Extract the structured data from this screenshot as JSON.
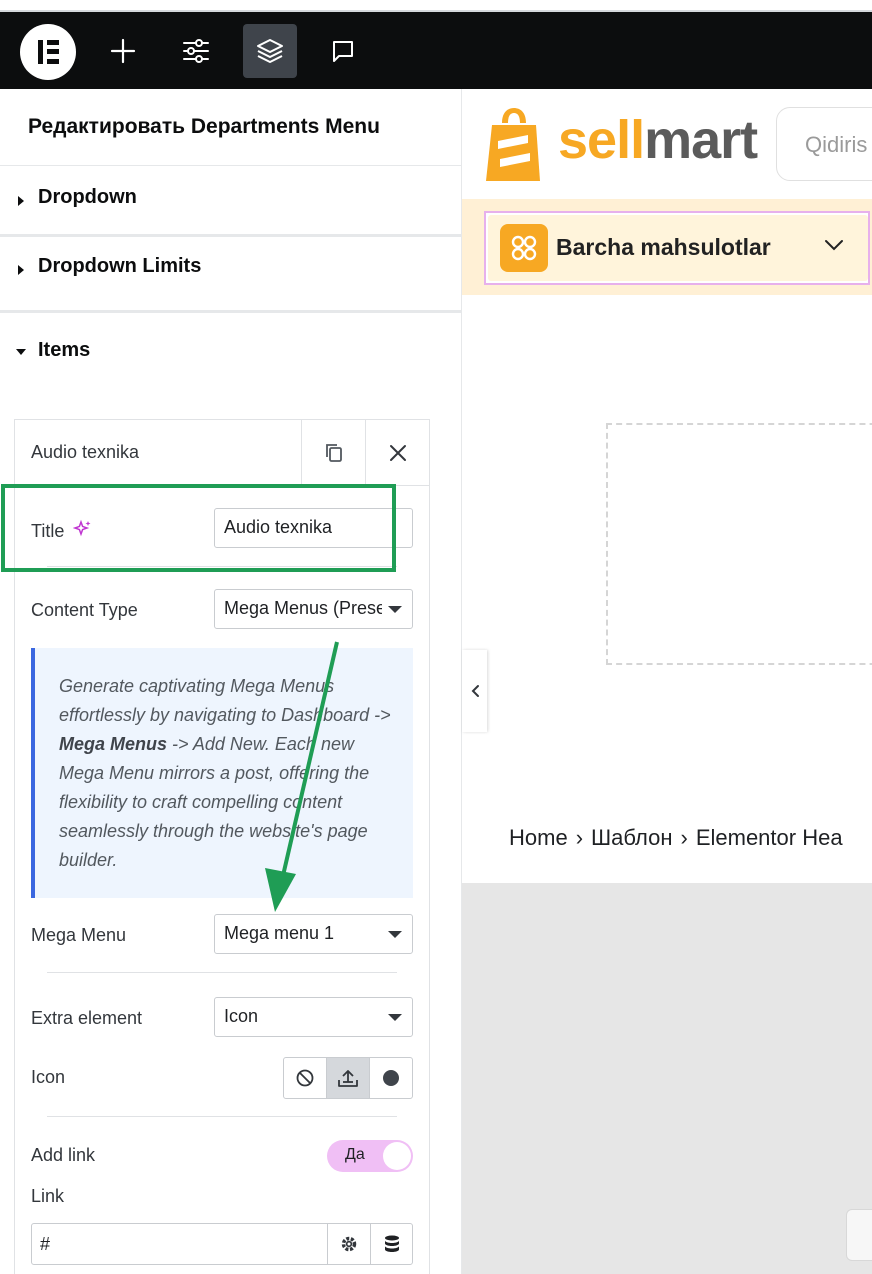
{
  "topbar": {
    "tools": [
      {
        "name": "add",
        "icon": "plus-icon"
      },
      {
        "name": "site-settings",
        "icon": "sliders-icon"
      },
      {
        "name": "structure",
        "icon": "layers-icon",
        "active": true
      },
      {
        "name": "notes",
        "icon": "comment-icon"
      }
    ]
  },
  "panel": {
    "title": "Редактировать Departments Menu",
    "sections": {
      "dropdown": "Dropdown",
      "dropdown_limits": "Dropdown Limits",
      "items": "Items"
    },
    "item": {
      "header_title": "Audio texnika",
      "title_label": "Title",
      "title_value": "Audio texnika",
      "content_type_label": "Content Type",
      "content_type_value": "Mega Menus (Preset)",
      "notice_pre": "Generate captivating Mega Menus effortlessly by navigating to Dashboard -> ",
      "notice_bold": "Mega Menus",
      "notice_post": " -> Add New. Each new Mega Menu mirrors a post, offering the flexibility to craft compelling content seamlessly through the website's page builder.",
      "mega_menu_label": "Mega Menu",
      "mega_menu_value": "Mega menu 1",
      "extra_element_label": "Extra element",
      "extra_element_value": "Icon",
      "icon_label": "Icon",
      "add_link_label": "Add link",
      "add_link_toggle": "Да",
      "link_label": "Link",
      "link_value": "#"
    }
  },
  "preview": {
    "brand_part1": "sell",
    "brand_part2": "mart",
    "search_placeholder": "Qidiris",
    "category_button": "Barcha mahsulotlar",
    "breadcrumbs": [
      "Home",
      "Шаблон",
      "Elementor Hea"
    ]
  },
  "colors": {
    "brand_orange": "#f7a823",
    "highlight_green": "#1f9d55",
    "toggle_pink": "#f0bff5",
    "notice_blue": "#3a67e0"
  }
}
